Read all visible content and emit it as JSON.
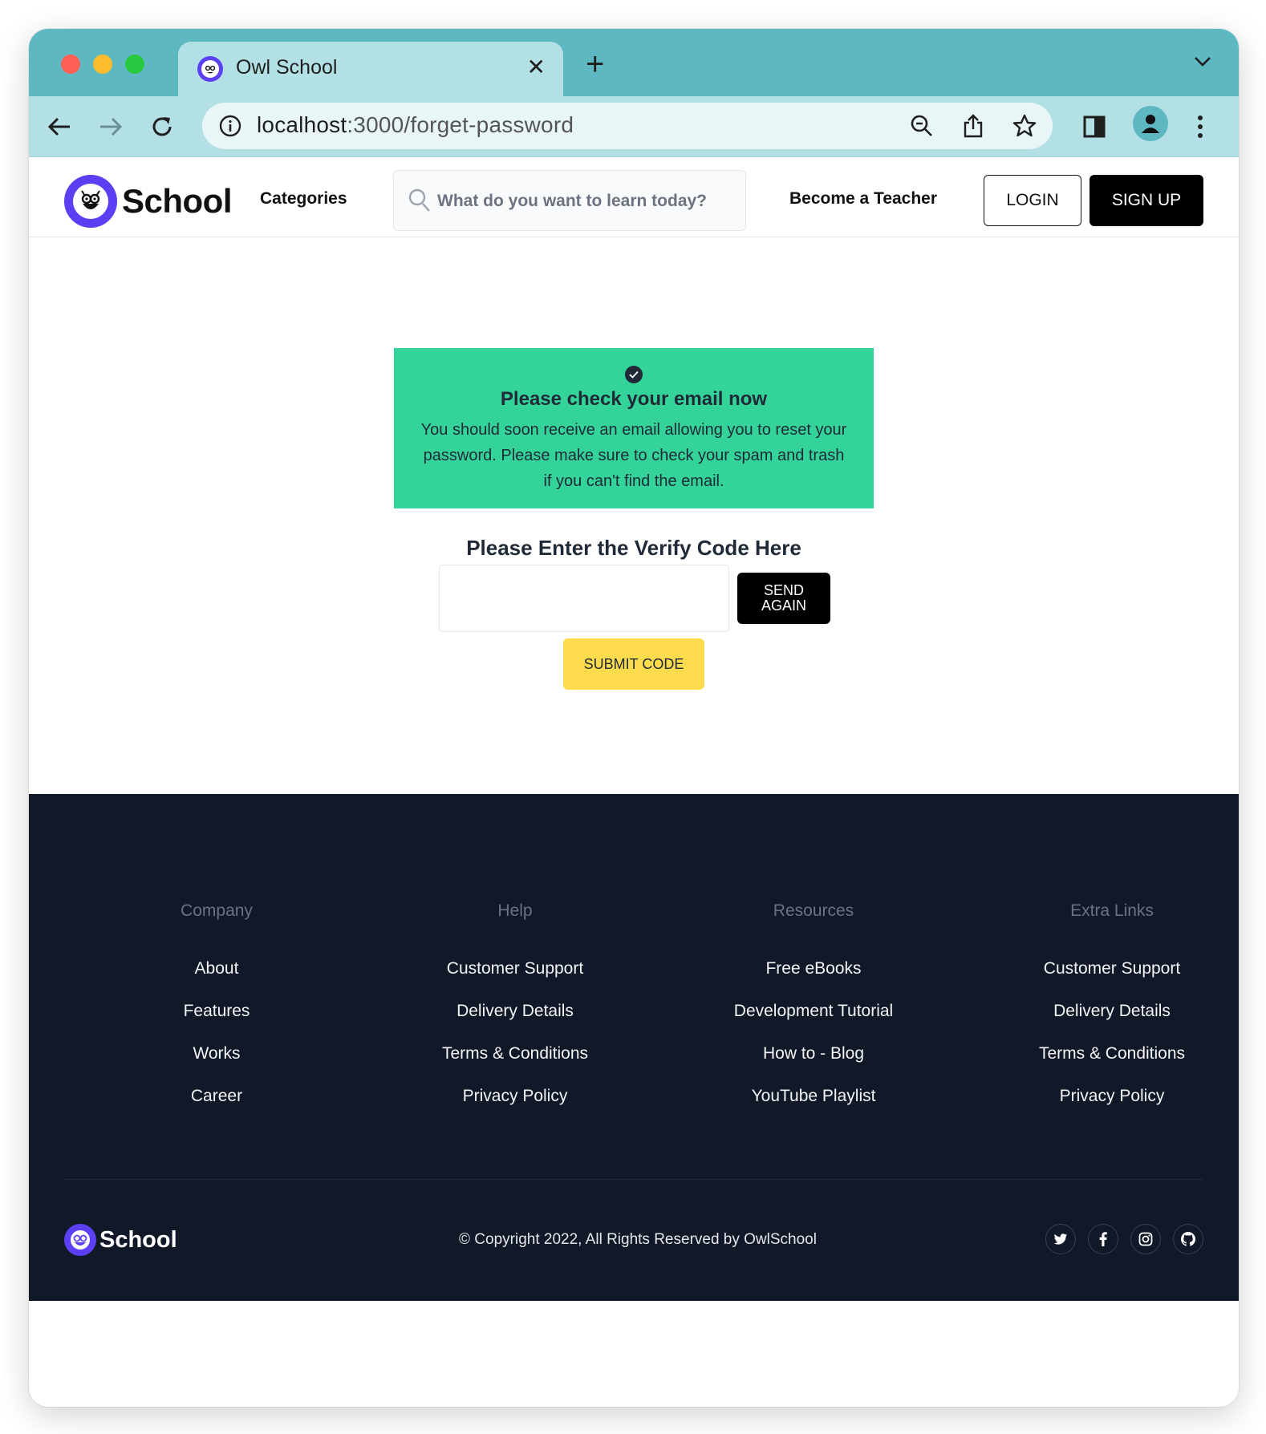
{
  "browser": {
    "tab_title": "Owl School",
    "tab_close": "✕",
    "new_tab": "+",
    "url_host": "localhost",
    "url_path": ":3000/forget-password"
  },
  "header": {
    "logo_text": "School",
    "categories": "Categories",
    "search_placeholder": "What do you want to learn today?",
    "become_teacher": "Become a Teacher",
    "login": "LOGIN",
    "signup": "SIGN UP"
  },
  "alert": {
    "title": "Please check your email now",
    "body": "You should soon receive an email allowing you to reset your password. Please make sure to check your spam and trash if you can't find the email.",
    "color": "#34d399"
  },
  "verify": {
    "title": "Please Enter the Verify Code Here",
    "code_value": "",
    "send_again": "SEND\nAGAIN",
    "submit": "SUBMIT CODE"
  },
  "footer": {
    "columns": [
      {
        "heading": "Company",
        "links": [
          "About",
          "Features",
          "Works",
          "Career"
        ]
      },
      {
        "heading": "Help",
        "links": [
          "Customer Support",
          "Delivery Details",
          "Terms & Conditions",
          "Privacy Policy"
        ]
      },
      {
        "heading": "Resources",
        "links": [
          "Free eBooks",
          "Development Tutorial",
          "How to - Blog",
          "YouTube Playlist"
        ]
      },
      {
        "heading": "Extra Links",
        "links": [
          "Customer Support",
          "Delivery Details",
          "Terms & Conditions",
          "Privacy Policy"
        ]
      }
    ],
    "logo_text": "School",
    "copyright": "© Copyright 2022, All Rights Reserved by OwlSchool",
    "socials": [
      "twitter-icon",
      "facebook-icon",
      "instagram-icon",
      "github-icon"
    ]
  },
  "colors": {
    "brand": "#5b3ff3",
    "browser_chrome": "#5db8c1",
    "footer_bg": "#111827",
    "submit_bg": "#fcdc4d"
  }
}
